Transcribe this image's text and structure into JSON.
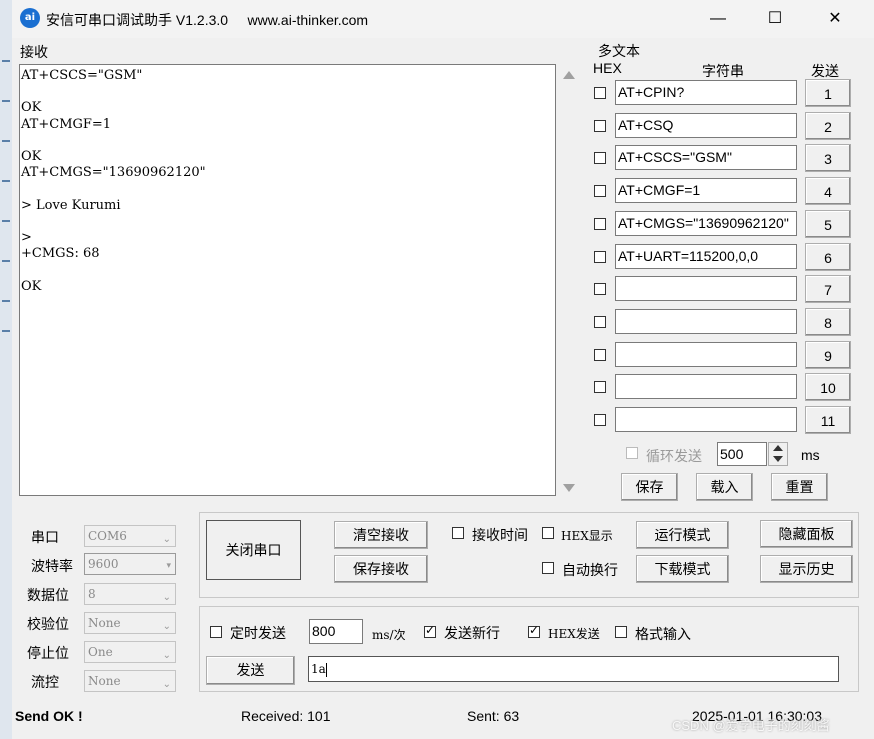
{
  "window": {
    "logo_text": "ai",
    "title": "安信可串口调试助手 V1.2.3.0     www.ai-thinker.com",
    "minimize": "—",
    "maximize": "☐",
    "close": "✕"
  },
  "receive": {
    "label": "接收",
    "text": "AT+CSCS=\"GSM\"\n\nOK\nAT+CMGF=1\n\nOK\nAT+CMGS=\"13690962120\"\n\n> Love Kurumi\n\n>\n+CMGS: 68\n\nOK"
  },
  "multi": {
    "group_label": "多文本",
    "hex_header": "HEX",
    "string_header": "字符串",
    "send_header": "发送",
    "rows": [
      {
        "value": "AT+CPIN?",
        "button": "1"
      },
      {
        "value": "AT+CSQ",
        "button": "2"
      },
      {
        "value": "AT+CSCS=\"GSM\"",
        "button": "3"
      },
      {
        "value": "AT+CMGF=1",
        "button": "4"
      },
      {
        "value": "AT+CMGS=\"13690962120\"",
        "button": "5"
      },
      {
        "value": "AT+UART=115200,0,0",
        "button": "6"
      },
      {
        "value": "",
        "button": "7"
      },
      {
        "value": "",
        "button": "8"
      },
      {
        "value": "",
        "button": "9"
      },
      {
        "value": "",
        "button": "10"
      },
      {
        "value": "",
        "button": "11"
      }
    ],
    "loop_label": "循环发送",
    "loop_value": "500",
    "loop_unit": "ms",
    "save": "保存",
    "load": "载入",
    "reset": "重置"
  },
  "port": {
    "port_label": "串口",
    "port_value": "COM6",
    "baud_label": "波特率",
    "baud_value": "9600",
    "data_label": "数据位",
    "data_value": "8",
    "parity_label": "校验位",
    "parity_value": "None",
    "stop_label": "停止位",
    "stop_value": "One",
    "flow_label": "流控",
    "flow_value": "None"
  },
  "controls": {
    "close_port": "关闭串口",
    "clear_recv": "清空接收",
    "save_recv": "保存接收",
    "recv_time": "接收时间",
    "hex_display": "HEX显示",
    "run_mode": "运行模式",
    "hide_panel": "隐藏面板",
    "auto_wrap": "自动换行",
    "download_mode": "下载模式",
    "show_history": "显示历史"
  },
  "send": {
    "timed_label": "定时发送",
    "interval": "800",
    "interval_unit": "ms/次",
    "newline_label": "发送新行",
    "hex_send_label": "HEX发送",
    "format_label": "格式输入",
    "send_button": "发送",
    "input_value": "1a"
  },
  "status": {
    "send_state": "Send OK !",
    "received": "Received: 101",
    "sent": "Sent: 63",
    "datetime": "2025-01-01 16:30:03",
    "watermark": "CSDN @爱学电子的刻刻酱"
  }
}
